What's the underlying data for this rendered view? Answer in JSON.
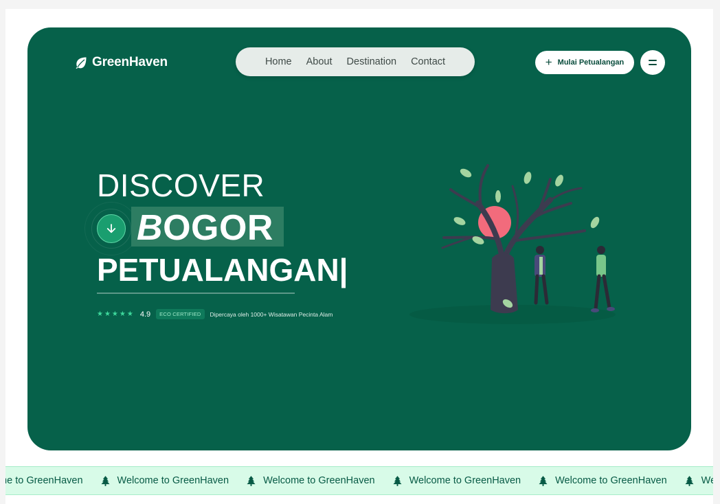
{
  "brand": {
    "name": "GreenHaven",
    "icon": "leaf-icon"
  },
  "nav": {
    "items": [
      "Home",
      "About",
      "Destination",
      "Contact"
    ]
  },
  "header": {
    "cta_label": "Mulai Petualangan",
    "cta_icon": "plus-icon",
    "menu_icon": "menu-icon"
  },
  "hero": {
    "line1": "DISCOVER",
    "line2_first": "B",
    "line2_rest": "OGOR",
    "line3": "PETUALANGAN|",
    "scroll_icon": "arrow-down-icon"
  },
  "rating": {
    "stars": "★★★★★",
    "score": "4.9",
    "badge": "ECO CERTIFIED",
    "trust": "Dipercaya oleh 1000+ Wisatawan Pecinta Alam"
  },
  "marquee": {
    "items": [
      "Welcome to GreenHaven",
      "Welcome to GreenHaven",
      "Welcome to GreenHaven",
      "Welcome to GreenHaven",
      "Welcome to GreenHaven",
      "Welcome to GreenHaven"
    ],
    "icon": "tree-icon"
  },
  "colors": {
    "hero_bg": "#06614a",
    "accent": "#3ed89c",
    "marquee_bg": "#d8fbe8",
    "marquee_text": "#075a45"
  }
}
